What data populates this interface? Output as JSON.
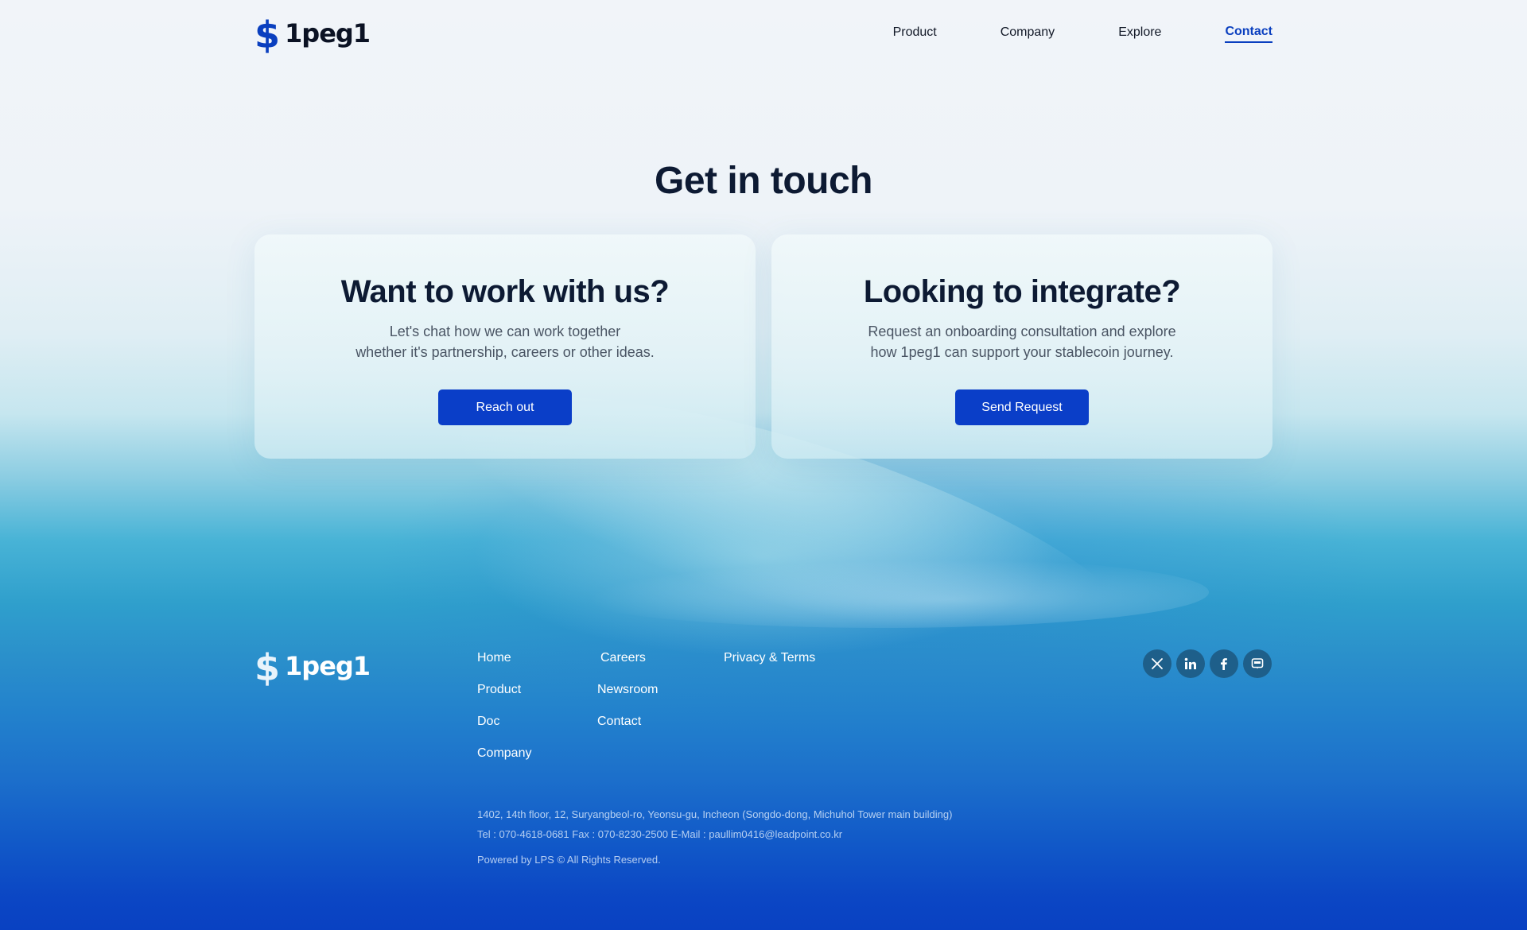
{
  "brand": {
    "name": "1peg1",
    "mark": "$"
  },
  "nav": {
    "items": [
      {
        "label": "Product",
        "active": false
      },
      {
        "label": "Company",
        "active": false
      },
      {
        "label": "Explore",
        "active": false
      },
      {
        "label": "Contact",
        "active": true
      }
    ]
  },
  "main": {
    "title": "Get in touch",
    "cards": [
      {
        "heading": "Want to work with us?",
        "line1": "Let's chat how we can work together",
        "line2": "whether it's partnership, careers or other ideas.",
        "button": "Reach out"
      },
      {
        "heading": "Looking to integrate?",
        "line1": "Request an onboarding consultation and explore",
        "line2": "how 1peg1 can support your stablecoin journey.",
        "button": "Send Request"
      }
    ]
  },
  "footer": {
    "col1": [
      "Home",
      "Product",
      "Doc",
      "Company"
    ],
    "col2": [
      "Careers",
      "Newsroom",
      "Contact"
    ],
    "col3": [
      "Privacy & Terms"
    ],
    "socials": [
      "x-icon",
      "linkedin-icon",
      "facebook-icon",
      "blog-icon"
    ],
    "address": "1402, 14th floor, 12, Suryangbeol-ro, Yeonsu-gu, Incheon (Songdo-dong, Michuhol Tower main building)",
    "contact": "Tel : 070-4618-0681 Fax : 070-8230-2500 E-Mail : paullim0416@leadpoint.co.kr",
    "copyright": "Powered by LPS © All Rights Reserved."
  },
  "colors": {
    "accent": "#0a3ec8",
    "heading": "#0d1a33"
  }
}
